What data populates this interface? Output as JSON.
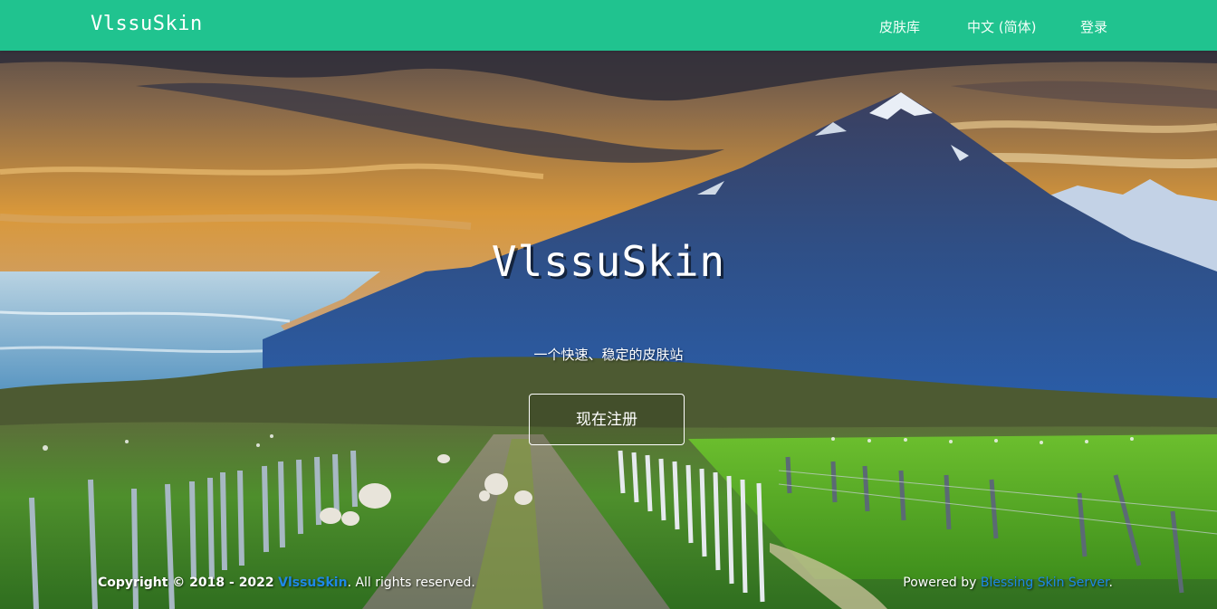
{
  "navbar": {
    "brand": "VlssuSkin",
    "items": [
      {
        "label": "皮肤库"
      },
      {
        "label": "中文 (简体)"
      },
      {
        "label": "登录"
      }
    ],
    "color": "#20c38f"
  },
  "hero": {
    "title": "VlssuSkin",
    "subtitle": "一个快速、稳定的皮肤站",
    "register_label": "现在注册"
  },
  "footer": {
    "copyright_prefix": "Copyright © 2018 - 2022",
    "site_link": "VlssuSkin",
    "rights": ". All rights reserved.",
    "powered_prefix": "Powered by",
    "powered_link": "Blessing Skin Server",
    "powered_suffix": "."
  },
  "colors": {
    "accent": "#20c38f",
    "link": "#1e88e5"
  }
}
